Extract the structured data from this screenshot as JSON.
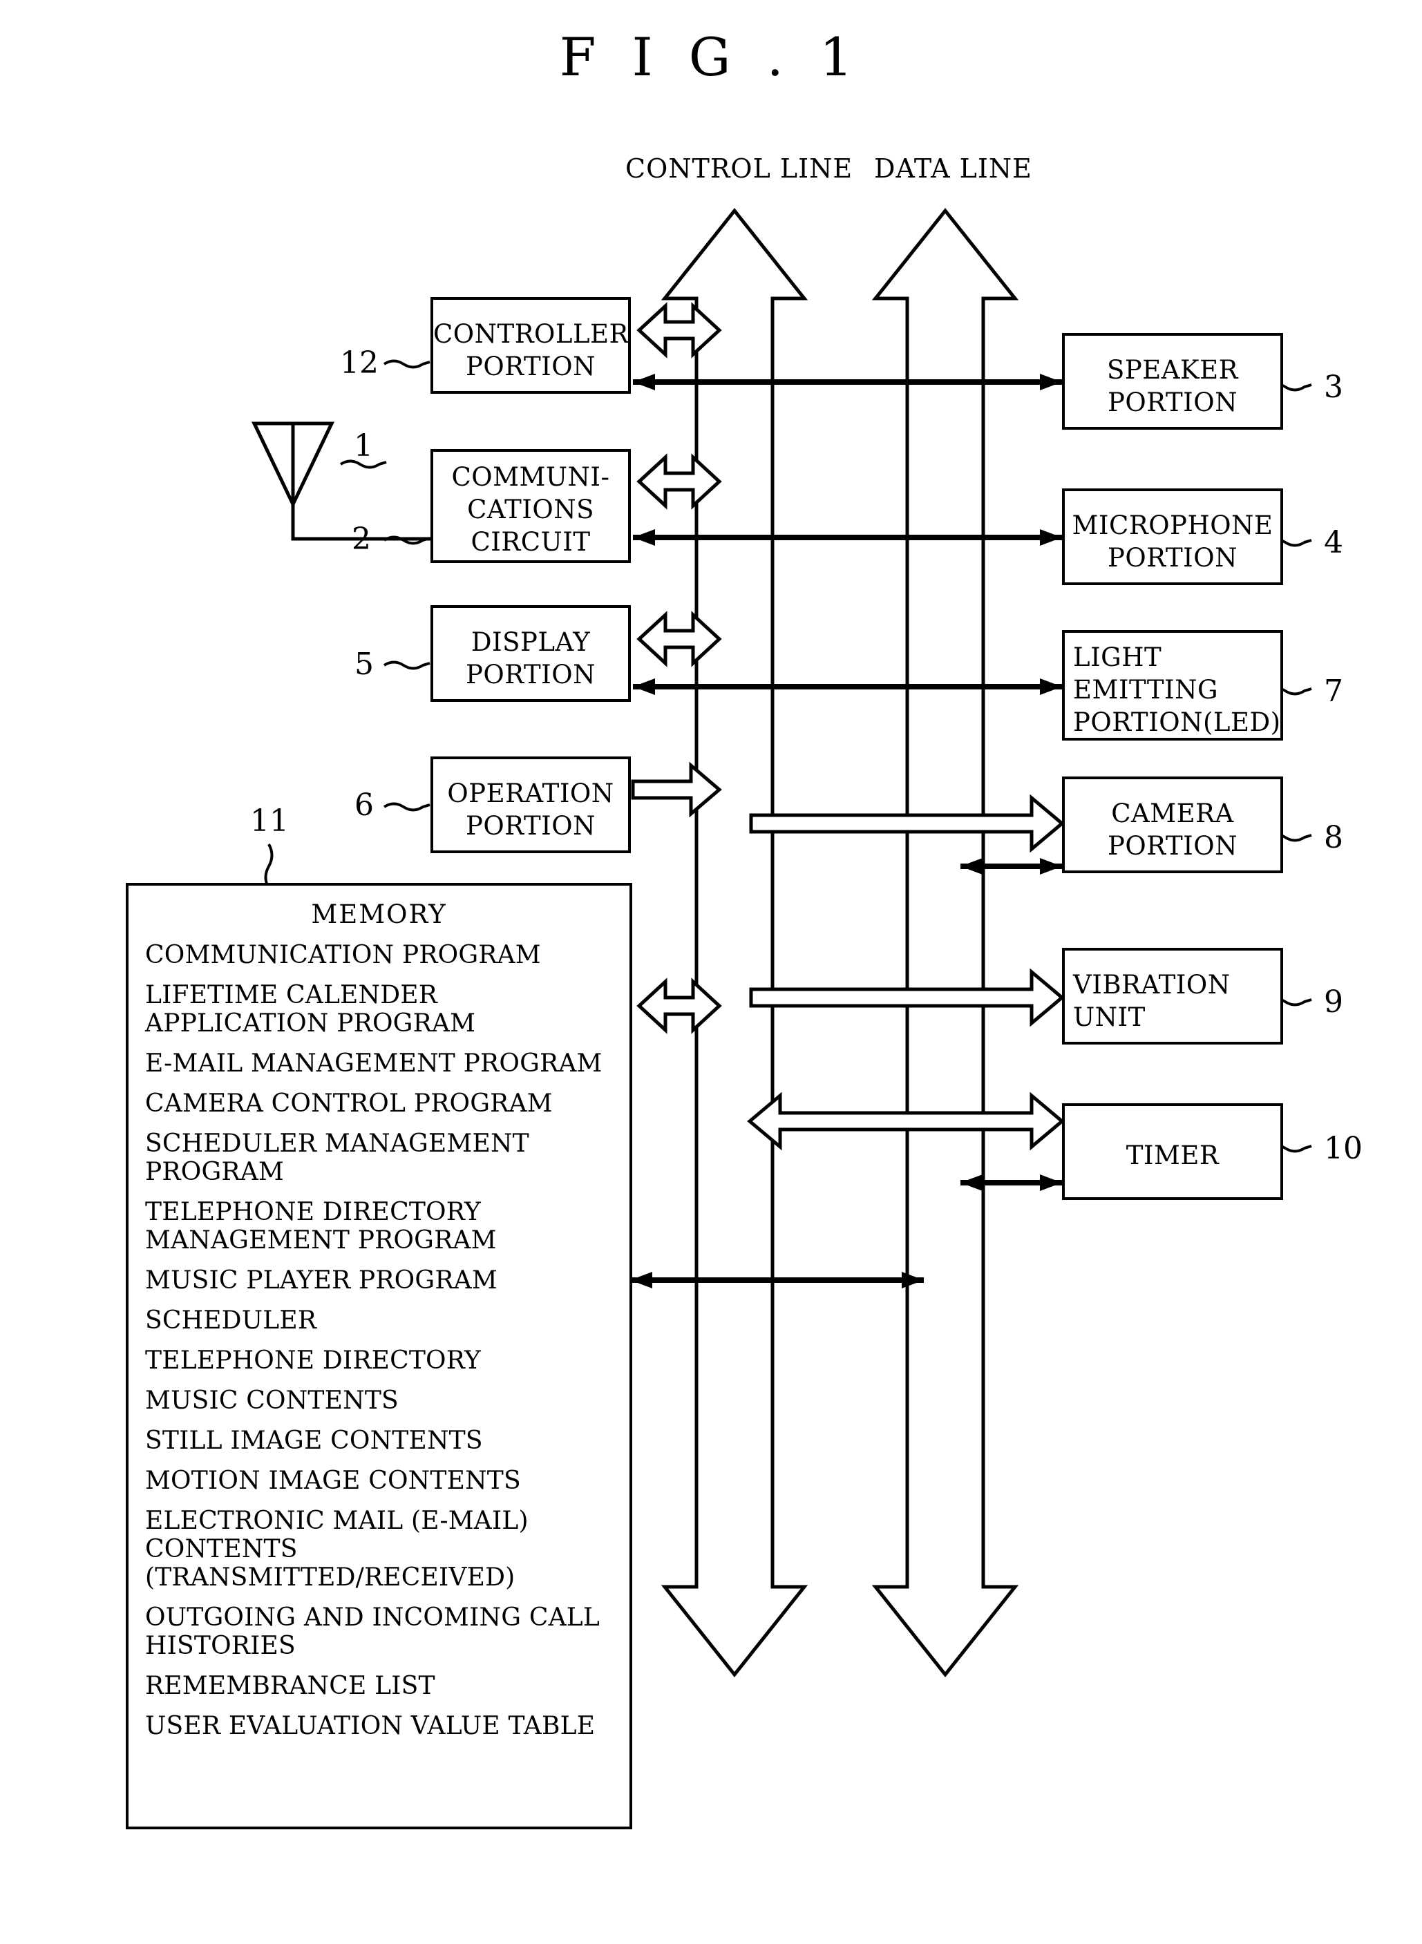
{
  "figure": {
    "title": "F I G . 1",
    "bus_labels": {
      "control": "CONTROL LINE",
      "data": "DATA LINE"
    }
  },
  "blocks": {
    "controller": {
      "label": "CONTROLLER\nPORTION",
      "ref": "12"
    },
    "antenna": {
      "label": "",
      "ref": "1"
    },
    "communications": {
      "label": "COMMUNI-\nCATIONS\nCIRCUIT",
      "ref": "2"
    },
    "display": {
      "label": "DISPLAY\nPORTION",
      "ref": "5"
    },
    "operation": {
      "label": "OPERATION\nPORTION",
      "ref": "6"
    },
    "memory": {
      "label": "MEMORY",
      "ref": "11"
    },
    "speaker": {
      "label": "SPEAKER\nPORTION",
      "ref": "3"
    },
    "microphone": {
      "label": "MICROPHONE\nPORTION",
      "ref": "4"
    },
    "light_emitting": {
      "label": "LIGHT\nEMITTING\nPORTION(LED)",
      "ref": "7"
    },
    "camera": {
      "label": "CAMERA\nPORTION",
      "ref": "8"
    },
    "vibration": {
      "label": "VIBRATION\nUNIT",
      "ref": "9"
    },
    "timer": {
      "label": "TIMER",
      "ref": "10"
    }
  },
  "memory_contents": [
    "COMMUNICATION PROGRAM",
    "LIFETIME CALENDER\nAPPLICATION PROGRAM",
    "E-MAIL MANAGEMENT PROGRAM",
    "CAMERA CONTROL PROGRAM",
    "SCHEDULER MANAGEMENT\nPROGRAM",
    "TELEPHONE DIRECTORY\nMANAGEMENT PROGRAM",
    "MUSIC PLAYER PROGRAM",
    "SCHEDULER",
    "TELEPHONE DIRECTORY",
    "MUSIC CONTENTS",
    "STILL IMAGE CONTENTS",
    "MOTION IMAGE CONTENTS",
    "ELECTRONIC MAIL (E-MAIL)\nCONTENTS\n(TRANSMITTED/RECEIVED)",
    "OUTGOING AND INCOMING CALL\nHISTORIES",
    "REMEMBRANCE LIST",
    "USER EVALUATION VALUE TABLE"
  ],
  "colors": {
    "stroke": "#000000",
    "background": "#ffffff"
  }
}
